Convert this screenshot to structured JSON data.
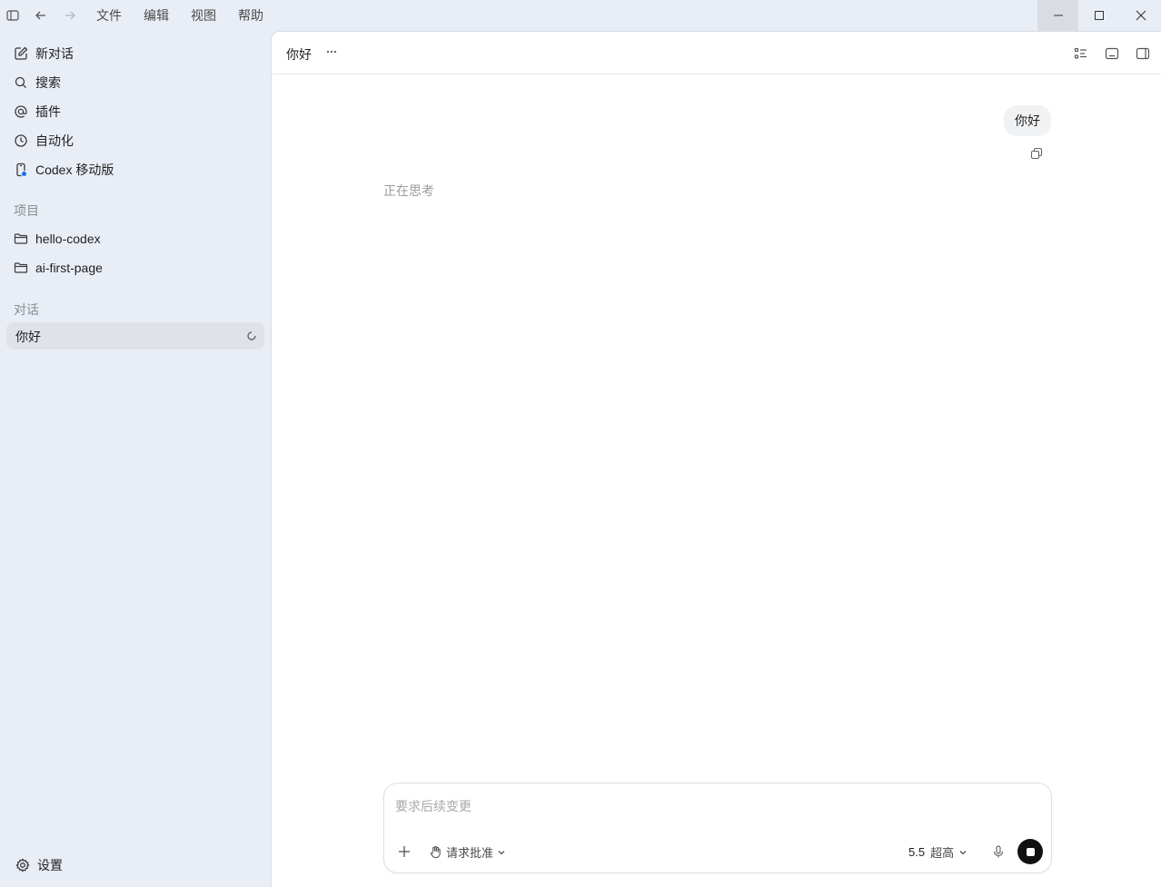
{
  "menubar": {
    "items": [
      "文件",
      "编辑",
      "视图",
      "帮助"
    ]
  },
  "sidebar": {
    "nav": [
      {
        "label": "新对话",
        "icon": "new-chat-icon"
      },
      {
        "label": "搜索",
        "icon": "search-icon"
      },
      {
        "label": "插件",
        "icon": "at-icon"
      },
      {
        "label": "自动化",
        "icon": "clock-icon"
      },
      {
        "label": "Codex 移动版",
        "icon": "phone-icon"
      }
    ],
    "projects_label": "项目",
    "projects": [
      {
        "label": "hello-codex",
        "icon": "folder-icon"
      },
      {
        "label": "ai-first-page",
        "icon": "folder-icon"
      }
    ],
    "conversations_label": "对话",
    "conversations": [
      {
        "label": "你好"
      }
    ],
    "settings_label": "设置"
  },
  "main": {
    "title": "你好",
    "messages": {
      "user": "你好",
      "assistant_status": "正在思考"
    },
    "composer": {
      "placeholder": "要求后续变更",
      "approval_label": "请求批准",
      "model_version": "5.5",
      "effort_label": "超高"
    }
  },
  "colors": {
    "sidebar_bg": "#e9eef6",
    "main_bg": "#ffffff",
    "active_item_bg": "#dfe3e9",
    "notification_dot": "#1a73e8",
    "stop_button": "#111111"
  }
}
